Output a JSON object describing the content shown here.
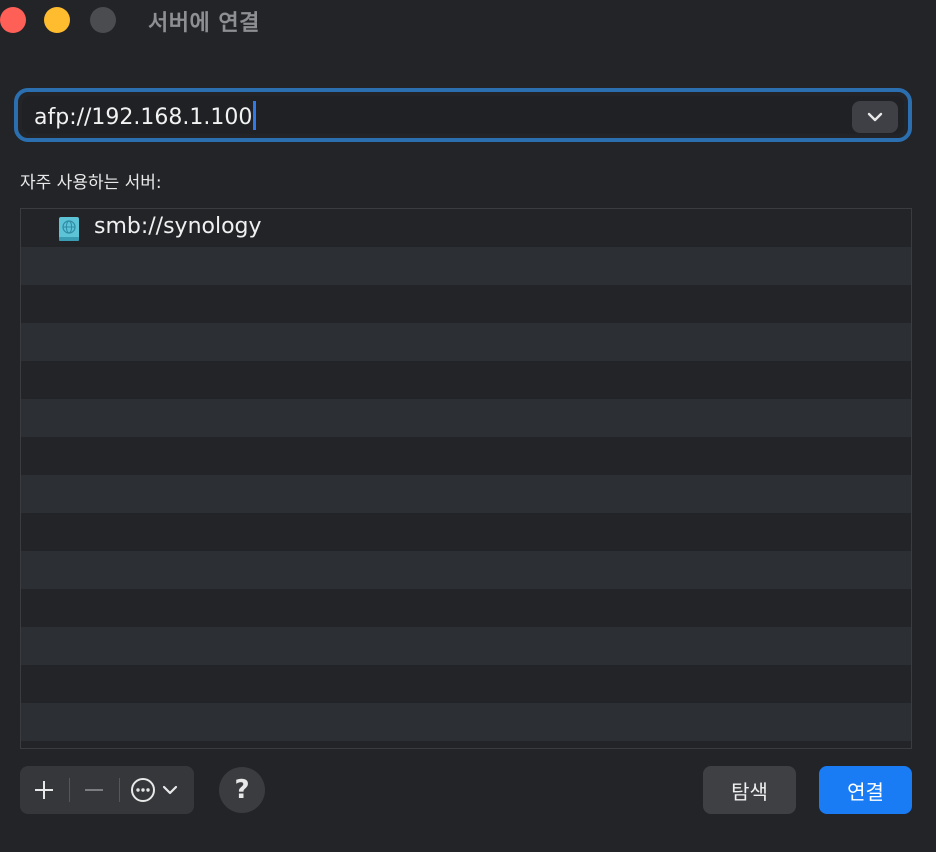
{
  "window": {
    "title": "서버에 연결",
    "colors": {
      "close": "#fe5f57",
      "minimize": "#febc2e",
      "zoom": "#4a4c50"
    }
  },
  "address": {
    "value": "afp://192.168.1.100",
    "dropdown_icon": "chevron-down-icon"
  },
  "favorites": {
    "label": "자주 사용하는 서버:",
    "items": [
      {
        "label": "smb://synology",
        "icon": "network-server-icon"
      }
    ]
  },
  "toolbar": {
    "add_icon": "plus-icon",
    "remove_icon": "minus-icon",
    "more_icon": "ellipsis-circle-icon",
    "help_label": "?",
    "browse_label": "탐색",
    "connect_label": "연결",
    "accent_color": "#1a7cf5"
  }
}
